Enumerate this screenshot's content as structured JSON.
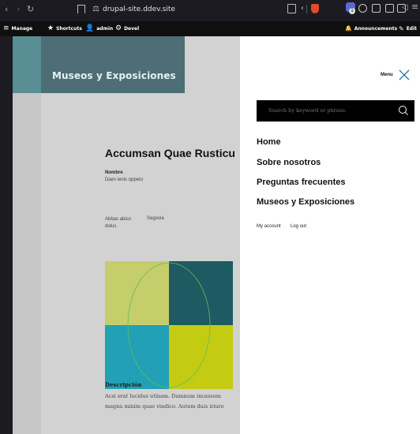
{
  "browser": {
    "url": "drupal-site.ddev.site",
    "extension_badge_count": "1"
  },
  "toolbar": {
    "manage": "Manage",
    "shortcuts": "Shortcuts",
    "user": "admin",
    "devel": "Devel",
    "announcements": "Announcements",
    "edit": "Edit"
  },
  "page": {
    "banner_title": "Museos y Exposiciones",
    "node_title": "Accumsan Quae Rusticu",
    "field_label": "Nombre",
    "field_value": "Diam ienis oppeto",
    "meta_a": "Abbas abico dolus",
    "meta_b": "Segovia",
    "description_label": "Descripción",
    "description_text": "Acsi erat lucidus utinam. Damnum incassum magna minim quae vindico. Autem duis iriure"
  },
  "art_colors": {
    "top_left": "#c6cd6b",
    "top_right": "#1e5a62",
    "bottom_left": "#22a0b5",
    "bottom_right": "#c4cb13",
    "ellipse": "#5fbf5a"
  },
  "menu": {
    "label": "Menu",
    "search_placeholder": "Search by keyword or phrase.",
    "links": [
      "Home",
      "Sobre nosotros",
      "Preguntas frecuentes",
      "Museos y Exposiciones"
    ],
    "account_links": [
      "My account",
      "Log out"
    ]
  }
}
